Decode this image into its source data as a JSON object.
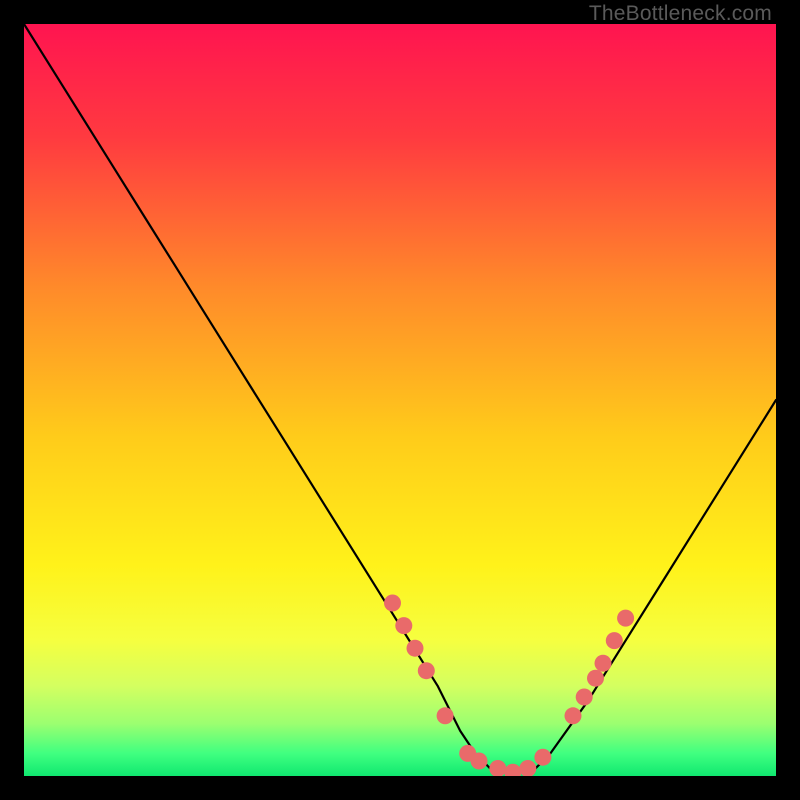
{
  "watermark": "TheBottleneck.com",
  "chart_data": {
    "type": "line",
    "title": "",
    "xlabel": "",
    "ylabel": "",
    "xrange": [
      0,
      100
    ],
    "yrange": [
      0,
      100
    ],
    "curve": {
      "name": "bottleneck-curve",
      "x": [
        0,
        5,
        10,
        15,
        20,
        25,
        30,
        35,
        40,
        45,
        50,
        55,
        58,
        60,
        62,
        65,
        68,
        70,
        75,
        80,
        85,
        90,
        95,
        100
      ],
      "y": [
        100,
        92,
        84,
        76,
        68,
        60,
        52,
        44,
        36,
        28,
        20,
        12,
        6,
        3,
        1,
        0.5,
        1,
        3,
        10,
        18,
        26,
        34,
        42,
        50
      ]
    },
    "markers": {
      "name": "highlight-points",
      "color": "#e96a6a",
      "points": [
        {
          "x": 49,
          "y": 23
        },
        {
          "x": 50.5,
          "y": 20
        },
        {
          "x": 52,
          "y": 17
        },
        {
          "x": 53.5,
          "y": 14
        },
        {
          "x": 56,
          "y": 8
        },
        {
          "x": 59,
          "y": 3
        },
        {
          "x": 60.5,
          "y": 2
        },
        {
          "x": 63,
          "y": 1
        },
        {
          "x": 65,
          "y": 0.5
        },
        {
          "x": 67,
          "y": 1
        },
        {
          "x": 69,
          "y": 2.5
        },
        {
          "x": 73,
          "y": 8
        },
        {
          "x": 74.5,
          "y": 10.5
        },
        {
          "x": 76,
          "y": 13
        },
        {
          "x": 77,
          "y": 15
        },
        {
          "x": 78.5,
          "y": 18
        },
        {
          "x": 80,
          "y": 21
        }
      ]
    },
    "gradient_bands": [
      {
        "stop": 0.0,
        "color": "#ff1450"
      },
      {
        "stop": 0.15,
        "color": "#ff3a40"
      },
      {
        "stop": 0.35,
        "color": "#ff8a2a"
      },
      {
        "stop": 0.55,
        "color": "#ffcc1a"
      },
      {
        "stop": 0.72,
        "color": "#fff21a"
      },
      {
        "stop": 0.82,
        "color": "#f5ff40"
      },
      {
        "stop": 0.88,
        "color": "#d4ff60"
      },
      {
        "stop": 0.93,
        "color": "#9cff70"
      },
      {
        "stop": 0.97,
        "color": "#40ff80"
      },
      {
        "stop": 1.0,
        "color": "#10e870"
      }
    ]
  }
}
